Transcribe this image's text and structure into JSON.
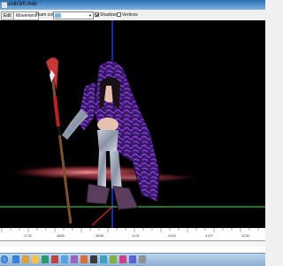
{
  "window": {
    "title": "s/sitr3/0.mdx"
  },
  "toolbar": {
    "tabs": [
      {
        "label": "Edit"
      },
      {
        "label": "Movement"
      }
    ],
    "team_color_label": "Team color",
    "team_color_value": "#7ab4e8",
    "shadows": {
      "label": "Shadows",
      "checked": true
    },
    "vertices": {
      "label": "Vertices",
      "checked": false
    }
  },
  "timeline": {
    "ticks": [
      "1732",
      "3865",
      "3898",
      "4131",
      "4164",
      "4197",
      "4230"
    ]
  },
  "taskbar": {
    "icons": [
      "start-orb-icon",
      "browser-icon",
      "media-icon",
      "folder-icon",
      "app-icon",
      "app-icon",
      "model-viewer-icon",
      "app-icon",
      "app-icon",
      "app-icon",
      "app-icon",
      "app-icon",
      "app-icon",
      "app-icon",
      "app-icon"
    ]
  }
}
